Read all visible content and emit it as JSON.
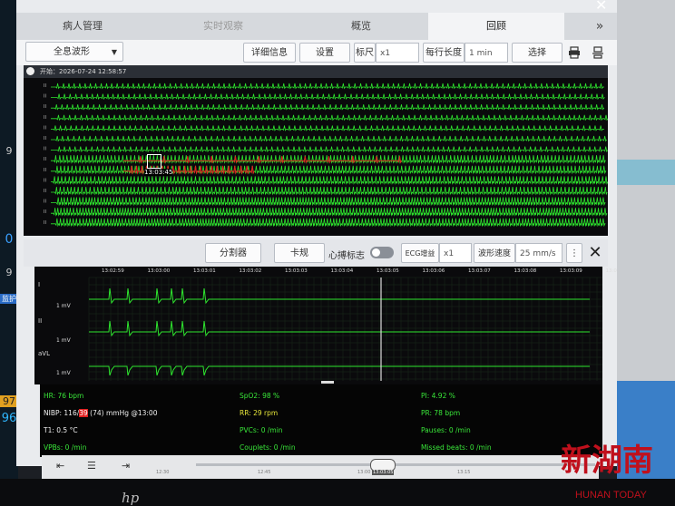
{
  "tabs": [
    "病人管理",
    "实时观察",
    "概览",
    "回顾"
  ],
  "more_icon": "»",
  "close_icon": "✕",
  "toolbar": {
    "waveform_select": "全息波形",
    "detail_info": "详细信息",
    "settings": "设置",
    "scale_label": "标尺",
    "scale_value": "x1",
    "row_len_label": "每行长度",
    "row_len_value": "1 min",
    "select": "选择"
  },
  "overview": {
    "start": "开始：2026-07-24 12:58:57",
    "lead_label": "II",
    "marker_time": "13:03:45"
  },
  "midbar": {
    "split": "分割器",
    "caliper": "卡规",
    "beat_mark": "心搏标志",
    "ecg_gain_label": "ECG增益",
    "ecg_gain_value": "x1",
    "speed_label": "波形速度",
    "speed_value": "25 mm/s",
    "more": "⋮"
  },
  "detail_times": [
    "13:02:59",
    "13:03:00",
    "13:03:01",
    "13:03:02",
    "13:03:03",
    "13:03:04",
    "13:03:05",
    "13:03:06",
    "13:03:07",
    "13:03:08",
    "13:03:09",
    "13:03"
  ],
  "detail_leads": [
    "I",
    "II",
    "aVL"
  ],
  "detail_scales": [
    "1 mV",
    "1 mV",
    "1 mV"
  ],
  "params": {
    "hr": "HR: 76 bpm",
    "nibp_prefix": "NIBP: 116/",
    "nibp_dia": "39",
    "nibp_suffix": " (74) mmHg @13:00",
    "t1": "T1: 0.5 °C",
    "vpbs": "VPBs: 0 /min",
    "spo2": "SpO2: 98 %",
    "rr": "RR: 29 rpm",
    "pvcs": "PVCs: 0 /min",
    "couplets": "Couplets: 0 /min",
    "pi": "PI: 4.92 %",
    "pr": "PR: 78 bpm",
    "pauses": "Pauses: 0 /min",
    "missed": "Missed beats: 0 /min"
  },
  "nav": {
    "left_arrow": "⇤",
    "list_icon": "☰",
    "right_arrow": "⇥",
    "timeline": [
      "12:30",
      "12:45",
      "13:00",
      "13:15"
    ],
    "current": "13:03:05"
  },
  "left_strip": [
    "9",
    "0",
    "9",
    "监护",
    "97",
    "96"
  ],
  "brand": "hp",
  "watermark": {
    "line1": "新湖南",
    "line2": "HUNAN TODAY"
  },
  "colors": {
    "wave": "#2ee62e",
    "alarm": "#e02020",
    "accent": "#3b6fd1"
  }
}
